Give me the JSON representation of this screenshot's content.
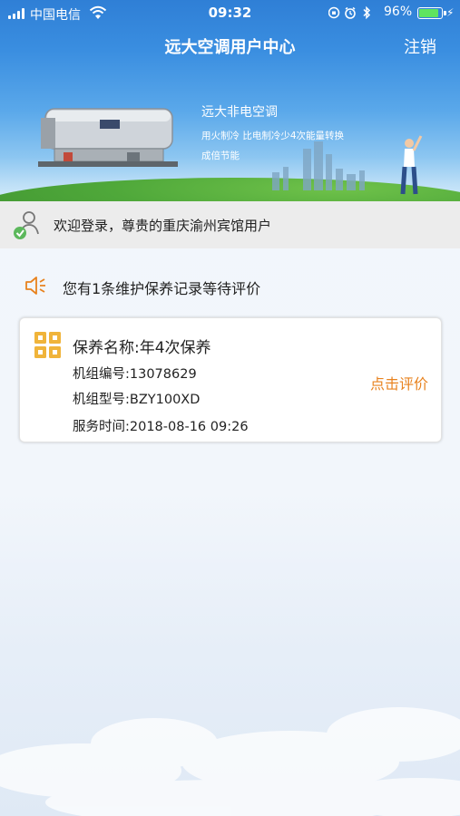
{
  "status_bar": {
    "carrier": "中国电信",
    "time": "09:32",
    "battery_percent": "96%",
    "battery_level": 0.96,
    "icons": [
      "signal-icon",
      "wifi-icon",
      "rotation-lock-icon",
      "alarm-icon",
      "bluetooth-icon",
      "battery-icon",
      "charging-icon"
    ]
  },
  "nav": {
    "title": "远大空调用户中心",
    "logout": "注销"
  },
  "banner": {
    "title": "远大非电空调",
    "line2": "用火制冷   比电制冷少4次能量转换",
    "line3": "成倍节能"
  },
  "welcome": {
    "text": "欢迎登录，尊贵的重庆渝州宾馆用户"
  },
  "notice": {
    "text": "您有1条维护保养记录等待评价"
  },
  "record": {
    "name": "保养名称:年4次保养",
    "unit_number": "机组编号:13078629",
    "unit_model": "机组型号:BZY100XD",
    "service_time": "服务时间:2018-08-16 09:26",
    "action": "点击评价"
  },
  "colors": {
    "header_blue": "#2f7fd6",
    "accent_orange": "#e8821e",
    "battery_green": "#5fe45f"
  }
}
